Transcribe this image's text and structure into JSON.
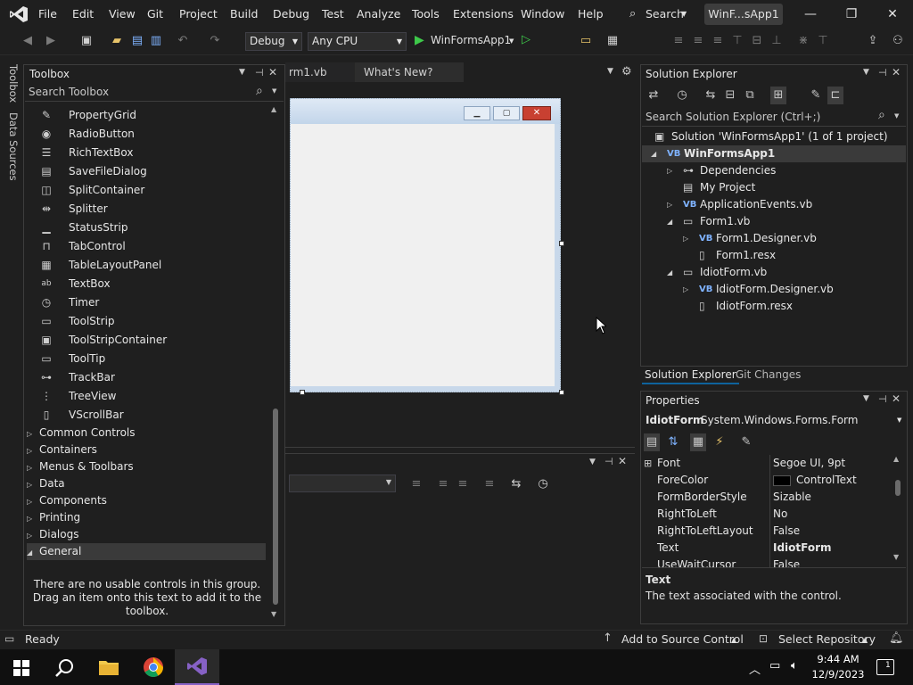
{
  "menubar": {
    "items": [
      "File",
      "Edit",
      "View",
      "Git",
      "Project",
      "Build",
      "Debug",
      "Test",
      "Analyze",
      "Tools",
      "Extensions",
      "Window",
      "Help"
    ],
    "search_label": "Search",
    "title_badge": "WinF...sApp1",
    "min_glyph": "—",
    "max_glyph": "❐",
    "close_glyph": "✕"
  },
  "toolbar": {
    "config": "Debug",
    "platform": "Any CPU",
    "run_label": "WinFormsApp1"
  },
  "side_tabs": [
    "Toolbox",
    "Data Sources"
  ],
  "toolbox": {
    "title": "Toolbox",
    "search_placeholder": "Search Toolbox",
    "items": [
      {
        "label": "PropertyGrid",
        "icon": "property-grid-icon"
      },
      {
        "label": "RadioButton",
        "icon": "radio-button-icon"
      },
      {
        "label": "RichTextBox",
        "icon": "rich-text-box-icon"
      },
      {
        "label": "SaveFileDialog",
        "icon": "save-file-dialog-icon"
      },
      {
        "label": "SplitContainer",
        "icon": "split-container-icon"
      },
      {
        "label": "Splitter",
        "icon": "splitter-icon"
      },
      {
        "label": "StatusStrip",
        "icon": "status-strip-icon"
      },
      {
        "label": "TabControl",
        "icon": "tab-control-icon"
      },
      {
        "label": "TableLayoutPanel",
        "icon": "table-layout-panel-icon"
      },
      {
        "label": "TextBox",
        "icon": "text-box-icon"
      },
      {
        "label": "Timer",
        "icon": "timer-icon"
      },
      {
        "label": "ToolStrip",
        "icon": "tool-strip-icon"
      },
      {
        "label": "ToolStripContainer",
        "icon": "tool-strip-container-icon"
      },
      {
        "label": "ToolTip",
        "icon": "tool-tip-icon"
      },
      {
        "label": "TrackBar",
        "icon": "track-bar-icon"
      },
      {
        "label": "TreeView",
        "icon": "tree-view-icon"
      },
      {
        "label": "VScrollBar",
        "icon": "vscroll-bar-icon"
      }
    ],
    "categories": [
      "Common Controls",
      "Containers",
      "Menus & Toolbars",
      "Data",
      "Components",
      "Printing",
      "Dialogs",
      "General"
    ],
    "empty_message": "There are no usable controls in this group. Drag an item onto this text to add it to the toolbox."
  },
  "editor": {
    "tabs": [
      "rm1.vb",
      "What's New?"
    ]
  },
  "solution_explorer": {
    "title": "Solution Explorer",
    "search_placeholder": "Search Solution Explorer (Ctrl+;)",
    "nodes": [
      {
        "label": "Solution 'WinFormsApp1' (1 of 1 project)",
        "icon": "solution-icon",
        "expander": ""
      },
      {
        "label": "WinFormsApp1",
        "icon": "vb-project-icon",
        "expander": "◢",
        "bold": true
      },
      {
        "label": "Dependencies",
        "icon": "dependencies-icon",
        "expander": "▷"
      },
      {
        "label": "My Project",
        "icon": "my-project-icon",
        "expander": ""
      },
      {
        "label": "ApplicationEvents.vb",
        "icon": "vb-file-icon",
        "expander": "▷"
      },
      {
        "label": "Form1.vb",
        "icon": "form-icon",
        "expander": "◢"
      },
      {
        "label": "Form1.Designer.vb",
        "icon": "vb-file-icon",
        "expander": "▷"
      },
      {
        "label": "Form1.resx",
        "icon": "resx-icon",
        "expander": ""
      },
      {
        "label": "IdiotForm.vb",
        "icon": "form-icon",
        "expander": "◢"
      },
      {
        "label": "IdiotForm.Designer.vb",
        "icon": "vb-file-icon",
        "expander": "▷"
      },
      {
        "label": "IdiotForm.resx",
        "icon": "resx-icon",
        "expander": ""
      }
    ],
    "bottom_tabs": [
      "Solution Explorer",
      "Git Changes"
    ]
  },
  "properties": {
    "title": "Properties",
    "object_name": "IdiotForm",
    "object_type": "System.Windows.Forms.Form",
    "rows": [
      {
        "name": "Font",
        "value": "Segoe UI, 9pt",
        "expander": "⊞"
      },
      {
        "name": "ForeColor",
        "value": "ControlText",
        "swatch": "#000000"
      },
      {
        "name": "FormBorderStyle",
        "value": "Sizable"
      },
      {
        "name": "RightToLeft",
        "value": "No"
      },
      {
        "name": "RightToLeftLayout",
        "value": "False"
      },
      {
        "name": "Text",
        "value": "IdiotForm",
        "bold": true
      },
      {
        "name": "UseWaitCursor",
        "value": "False"
      }
    ],
    "desc_title": "Text",
    "desc_text": "The text associated with the control."
  },
  "statusbar": {
    "ready": "Ready",
    "source_control": "Add to Source Control",
    "repository": "Select Repository"
  },
  "taskbar": {
    "time": "9:44 AM",
    "date": "12/9/2023",
    "notification_count": "1"
  },
  "colors": {
    "accent": "#0e639c",
    "vs_purple": "#8661c5",
    "run_green": "#3ec94a",
    "selection": "#3a3a3a"
  }
}
